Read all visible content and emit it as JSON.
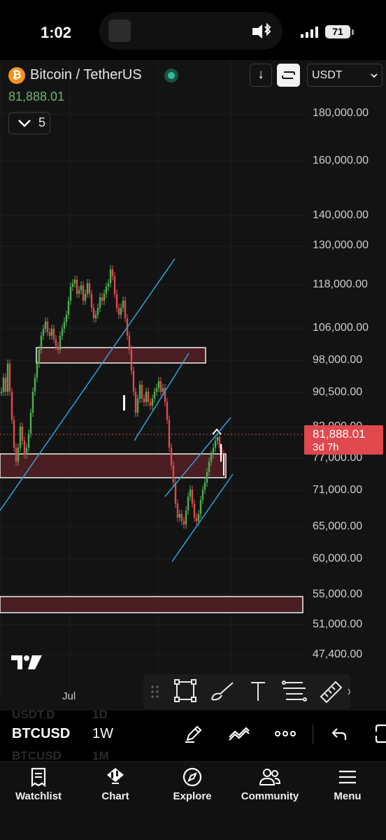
{
  "status_bar": {
    "time": "1:02",
    "battery": "71"
  },
  "header": {
    "symbol_title": "Bitcoin / TetherUS",
    "last_price": "81,888.01",
    "indicator_count": "5",
    "currency": "USDT",
    "logo_letter": "₿"
  },
  "price_scale": {
    "labels": [
      "180,000.00",
      "160,000.00",
      "140,000.00",
      "130,000.00",
      "118,000.00",
      "106,000.00",
      "98,000.00",
      "90,500.00",
      "82,000.00",
      "77,000.00",
      "71,000.00",
      "65,000.00",
      "60,000.00",
      "55,000.00",
      "51,000.00",
      "47,400.00"
    ],
    "current_price": "81,888.01",
    "countdown": "3d 7h"
  },
  "time_scale": {
    "label": "Jul"
  },
  "symbol_bar": {
    "symbol": "BTCUSD",
    "interval": "1W",
    "ghost_above_symbol": "USDT.D",
    "ghost_above_interval": "1D",
    "ghost_below_symbol": "BTCUSD",
    "ghost_below_interval": "1M"
  },
  "colors": {
    "up": "#4caf50",
    "down": "#e0484e",
    "zone": "#4a1d22",
    "trendline": "#2aa7d8",
    "accent": "#2bbf97"
  },
  "icons": [
    "bitcoin-icon",
    "bluetooth-icon",
    "signal-icon",
    "chevron-down-icon",
    "arrow-down-icon",
    "cycle-icon",
    "drag-handle-icon",
    "rectangle-icon",
    "brush-icon",
    "text-icon",
    "fib-icon",
    "ruler-icon",
    "pen-icon",
    "chart-type-icon",
    "more-icon",
    "undo-icon",
    "layout-icon",
    "watchlist-icon",
    "chart-icon",
    "explore-icon",
    "community-icon",
    "menu-icon"
  ],
  "tabs": [
    {
      "label": "Watchlist",
      "icon": "watchlist-icon"
    },
    {
      "label": "Chart",
      "icon": "chart-icon"
    },
    {
      "label": "Explore",
      "icon": "explore-icon"
    },
    {
      "label": "Community",
      "icon": "community-icon"
    },
    {
      "label": "Menu",
      "icon": "menu-icon"
    }
  ]
}
